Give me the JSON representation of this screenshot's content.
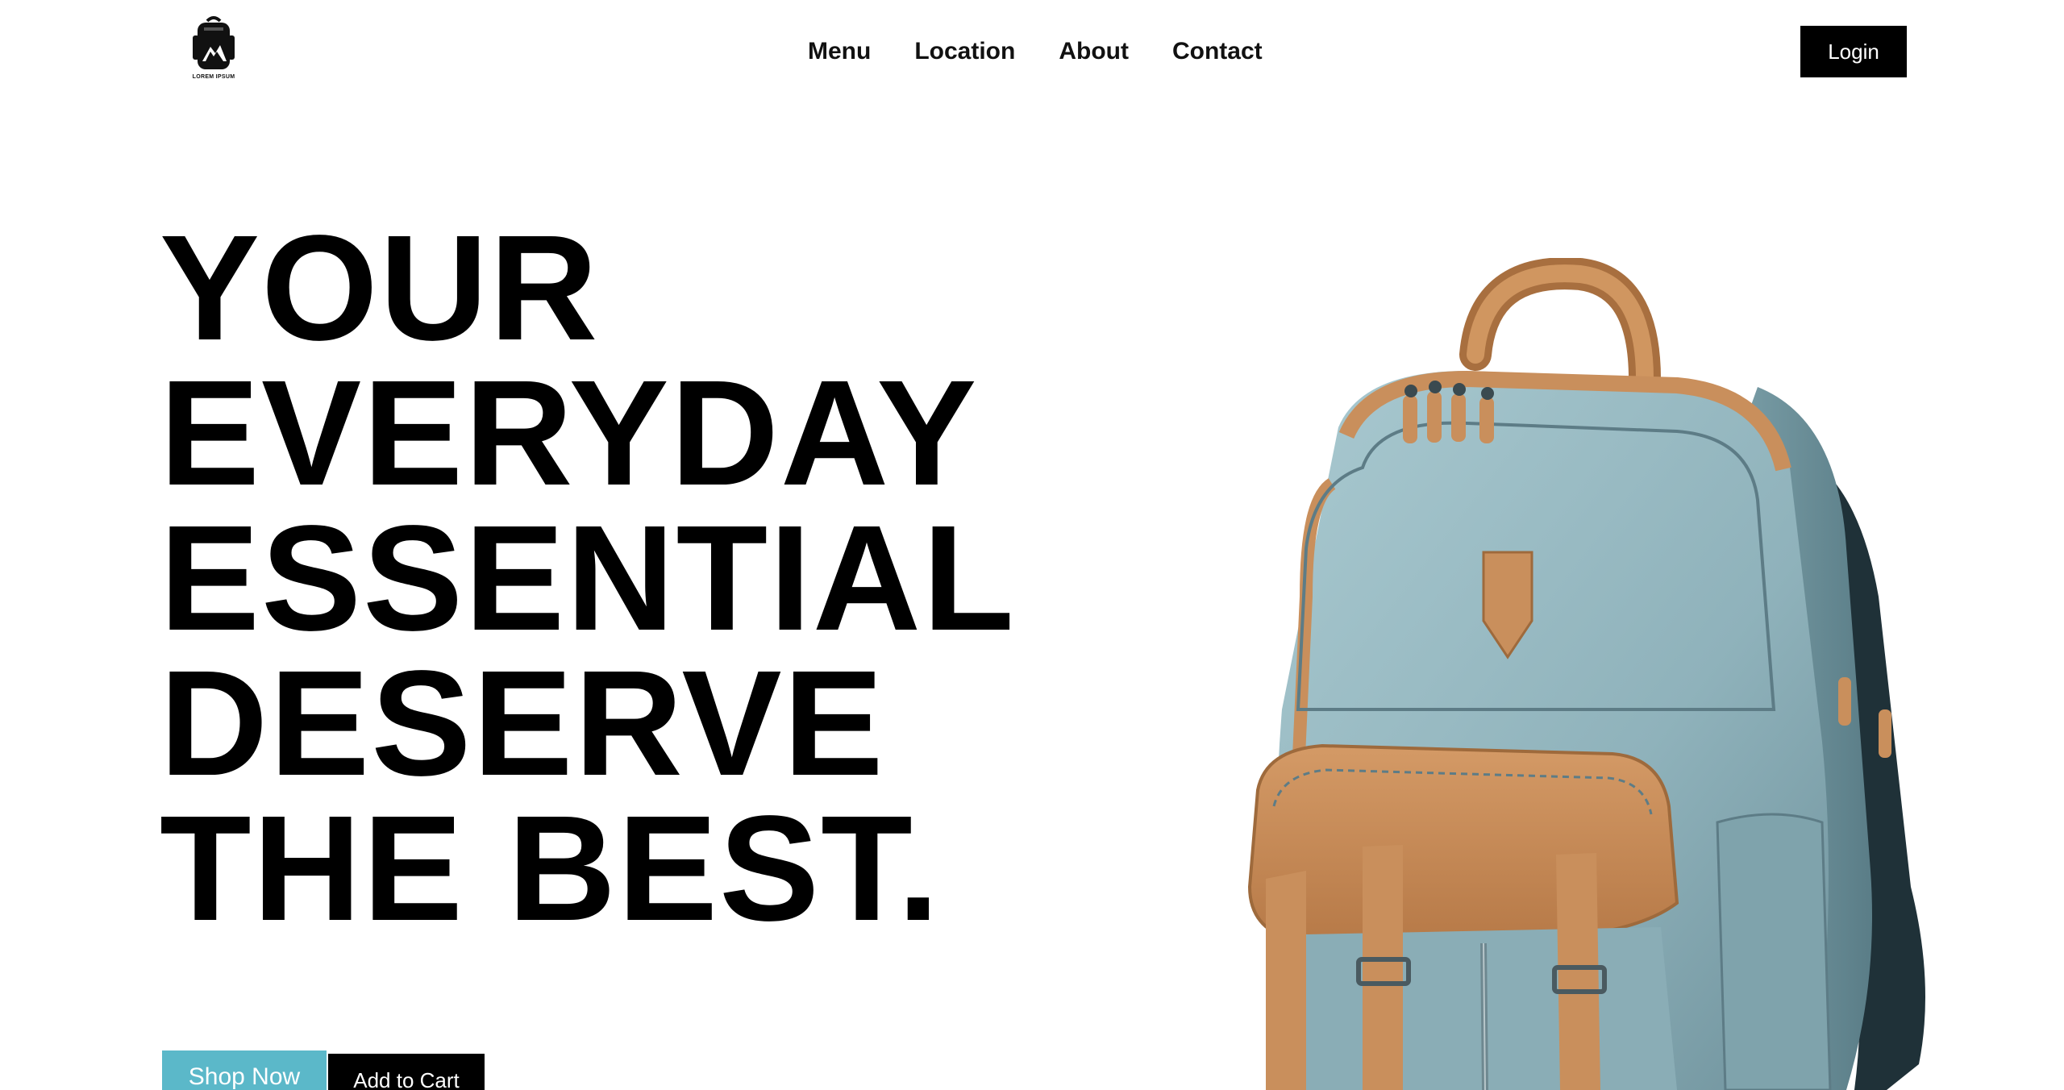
{
  "header": {
    "logo_text": "LOREM IPSUM",
    "nav": [
      {
        "label": "Menu"
      },
      {
        "label": "Location"
      },
      {
        "label": "About"
      },
      {
        "label": "Contact"
      }
    ],
    "login_label": "Login"
  },
  "hero": {
    "headline_lines": [
      "YOUR",
      "EVERYDAY",
      "ESSENTIAL",
      "DESERVE",
      "THE BEST."
    ],
    "shop_now_label": "Shop Now",
    "add_to_cart_label": "Add to Cart",
    "image_icon": "backpack-illustration"
  },
  "colors": {
    "accent": "#5bb8c9",
    "primary_button": "#000000",
    "text": "#000000",
    "background": "#ffffff",
    "backpack_body": "#8fb4bd",
    "backpack_leather": "#c98f5c"
  }
}
